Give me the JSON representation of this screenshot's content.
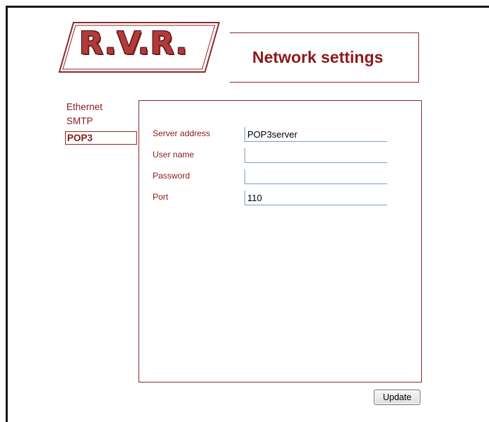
{
  "logo": {
    "text": "R.V.R."
  },
  "header": {
    "title": "Network settings"
  },
  "sidebar": {
    "items": [
      {
        "label": "Ethernet",
        "selected": false
      },
      {
        "label": "SMTP",
        "selected": false
      },
      {
        "label": "POP3",
        "selected": true
      }
    ]
  },
  "form": {
    "fields": [
      {
        "label": "Server address",
        "value": "POP3server"
      },
      {
        "label": "User name",
        "value": ""
      },
      {
        "label": "Password",
        "value": ""
      },
      {
        "label": "Port",
        "value": "110"
      }
    ],
    "update_label": "Update"
  },
  "colors": {
    "accent": "#8b1a1a",
    "frame": "#1a1a1a",
    "input_border": "#7f9db9"
  }
}
